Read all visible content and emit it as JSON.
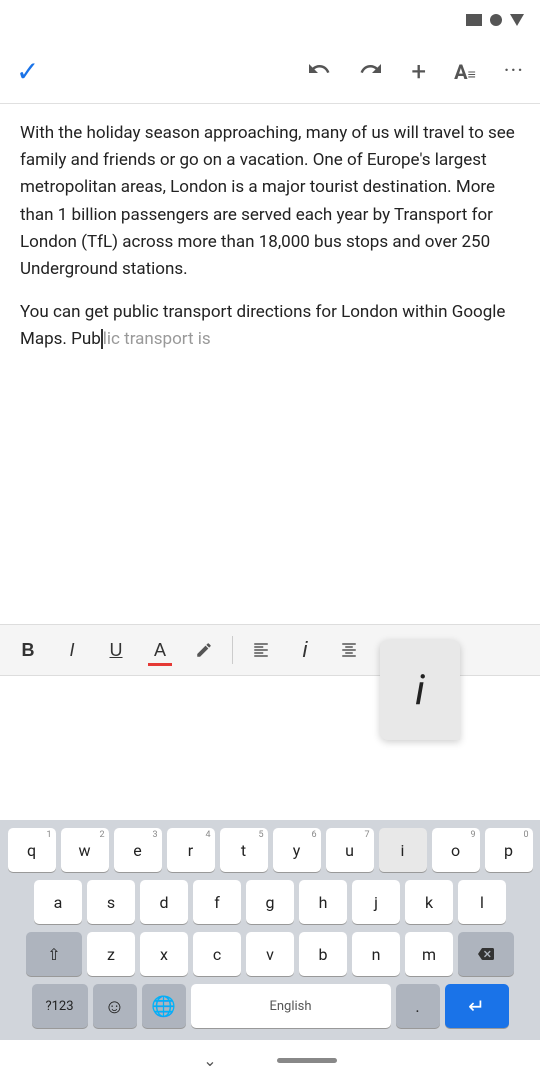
{
  "statusBar": {
    "icons": [
      "rectangle",
      "circle",
      "triangle"
    ]
  },
  "toolbar": {
    "check": "✓",
    "undo": "↩",
    "redo": "↪",
    "add": "+",
    "format": "A≡",
    "more": "⋯"
  },
  "content": {
    "paragraph1": "With the holiday season approaching, many of us will travel to see family and friends or go on a vacation. One of Europe's largest metropolitan areas, London is a major tourist destination. More than 1 billion passengers are served each year by Transport for London (TfL) across more than 18,000 bus stops and over 250 Underground stations.",
    "paragraph2_before": "You can get public transport directions for London within Google Maps. Pub",
    "paragraph2_after": "lic transport is"
  },
  "formatToolbar": {
    "bold": "B",
    "italic": "I",
    "underline": "U",
    "color": "A",
    "pen": "✏",
    "alignLeft": "≡",
    "italic2": "i",
    "alignCenter": "≡",
    "listOrdered": "≡"
  },
  "popupKey": {
    "letter": "i"
  },
  "keyboard": {
    "row1": [
      {
        "label": "q",
        "num": "1"
      },
      {
        "label": "w",
        "num": "2"
      },
      {
        "label": "e",
        "num": "3"
      },
      {
        "label": "r",
        "num": "4"
      },
      {
        "label": "t",
        "num": "5"
      },
      {
        "label": "y",
        "num": "6"
      },
      {
        "label": "u",
        "num": "7"
      },
      {
        "label": "i",
        "num": "",
        "highlighted": true
      },
      {
        "label": "o",
        "num": "9"
      },
      {
        "label": "p",
        "num": "0"
      }
    ],
    "row2": [
      {
        "label": "a"
      },
      {
        "label": "s"
      },
      {
        "label": "d"
      },
      {
        "label": "f"
      },
      {
        "label": "g"
      },
      {
        "label": "h"
      },
      {
        "label": "j"
      },
      {
        "label": "k"
      },
      {
        "label": "l"
      }
    ],
    "row3": [
      {
        "label": "⇧",
        "type": "shift"
      },
      {
        "label": "z"
      },
      {
        "label": "x"
      },
      {
        "label": "c"
      },
      {
        "label": "v"
      },
      {
        "label": "b"
      },
      {
        "label": "n"
      },
      {
        "label": "m"
      },
      {
        "label": "⌫",
        "type": "backspace"
      }
    ],
    "row4": [
      {
        "label": "?123",
        "type": "num-sym"
      },
      {
        "label": "☺",
        "type": "emoji"
      },
      {
        "label": "🌐",
        "type": "globe"
      },
      {
        "label": "English",
        "type": "space"
      },
      {
        "label": ".",
        "type": "dot"
      },
      {
        "label": "↵",
        "type": "enter"
      }
    ]
  },
  "bottomBar": {
    "chevron": "⌄",
    "pill": ""
  }
}
